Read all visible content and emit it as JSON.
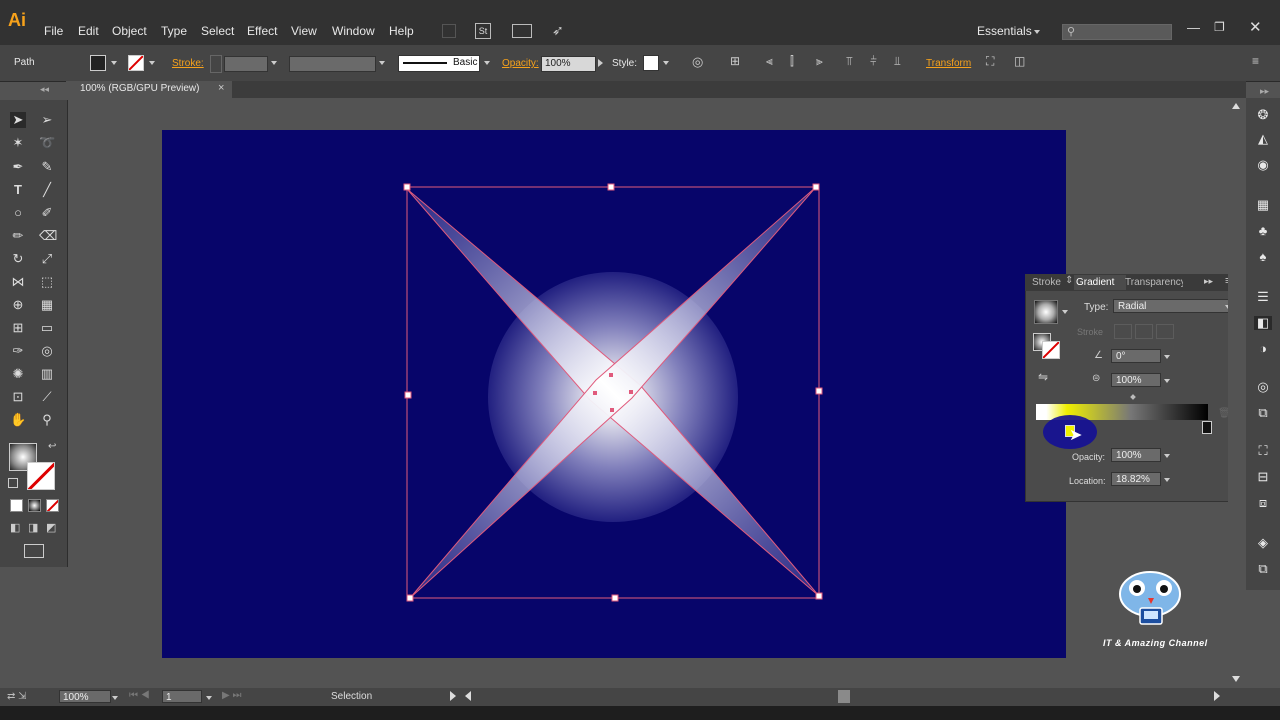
{
  "app": {
    "logo": "Ai"
  },
  "menu": [
    "File",
    "Edit",
    "Object",
    "Type",
    "Select",
    "Effect",
    "View",
    "Window",
    "Help"
  ],
  "menubar_extra": {
    "st_label": "St",
    "workspace": "Essentials"
  },
  "control": {
    "selection_label": "Path",
    "stroke_label": "Stroke:",
    "brush_label": "Basic",
    "opacity_label": "Opacity:",
    "opacity_value": "100%",
    "style_label": "Style:",
    "transform_label": "Transform"
  },
  "document_tab": {
    "title": "100% (RGB/GPU Preview)",
    "close": "×"
  },
  "gradient_panel": {
    "tabs": [
      "Stroke",
      "Gradient",
      "Transparency"
    ],
    "type_label": "Type:",
    "type_value": "Radial",
    "stroke_label": "Stroke",
    "angle_value": "0°",
    "aspect_value": "100%",
    "opacity_label": "Opacity:",
    "opacity_value": "100%",
    "location_label": "Location:",
    "location_value": "18.82%"
  },
  "status": {
    "zoom": "100%",
    "artboard_number": "1",
    "tool_name": "Selection"
  },
  "watermark": {
    "text": "IT & Amazing Channel"
  },
  "colors": {
    "artboard": "#07056a",
    "accent": "#f7a21b",
    "selection": "#e05a7c",
    "gradient_stop_yellow": "#f0f000"
  }
}
